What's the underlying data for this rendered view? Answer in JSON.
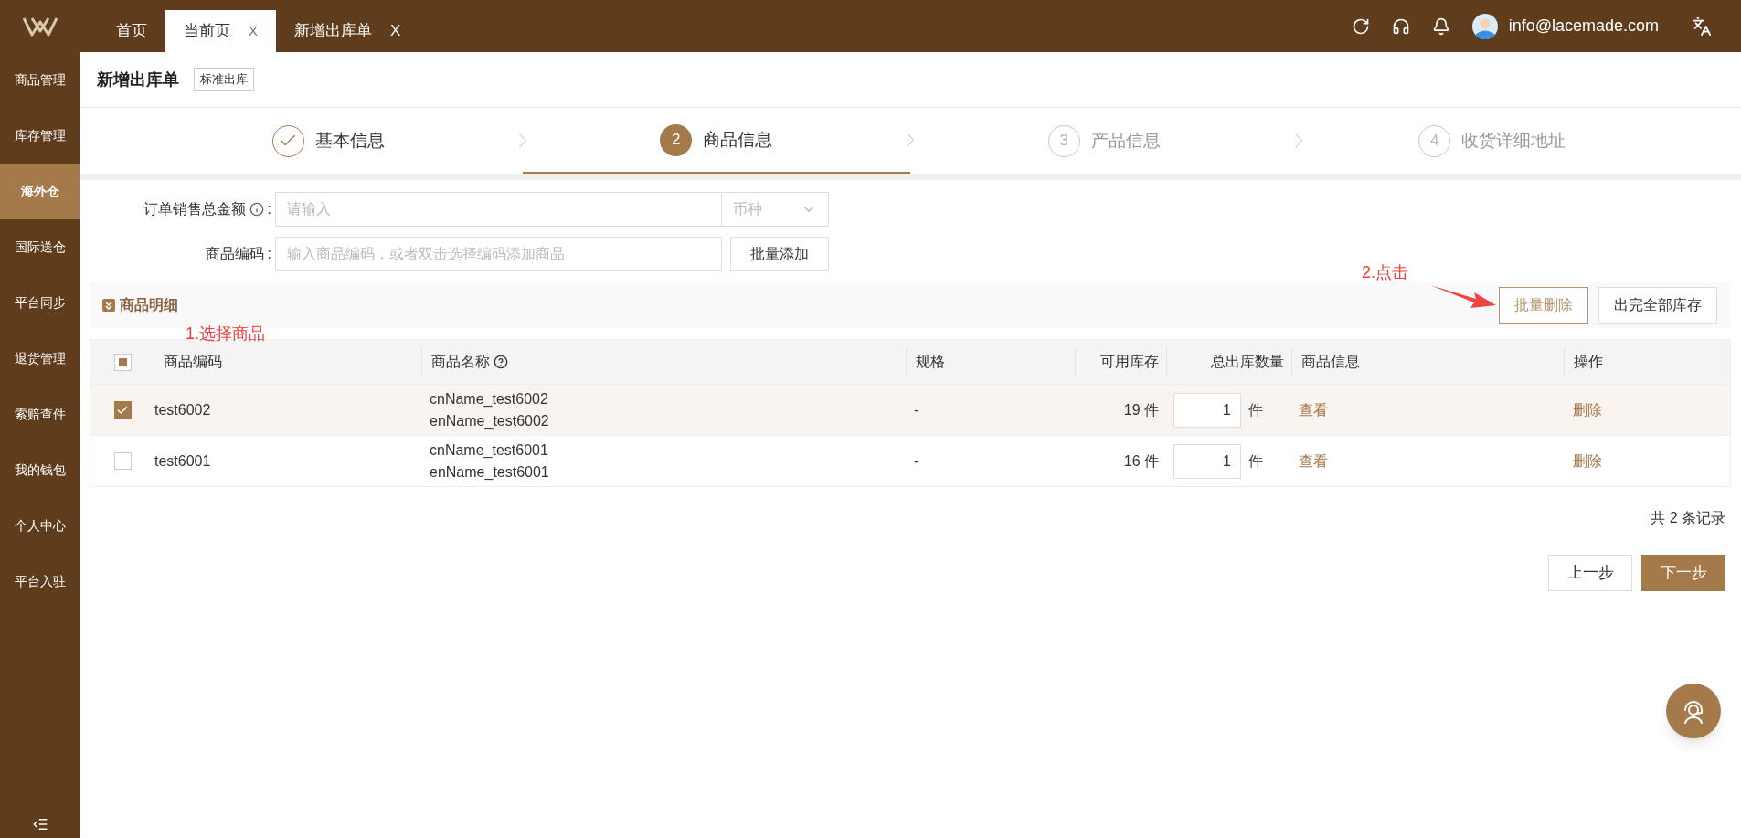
{
  "topbar": {
    "tabs": [
      {
        "label": "首页",
        "selected": false
      },
      {
        "label": "当前页",
        "selected": true,
        "close": "X"
      },
      {
        "label": "新增出库单",
        "selected": false,
        "close": "X"
      }
    ],
    "user": "info@lacemade.com"
  },
  "sidebar": {
    "items": [
      {
        "label": "商品管理",
        "selected": false
      },
      {
        "label": "库存管理",
        "selected": false
      },
      {
        "label": "海外仓",
        "selected": true
      },
      {
        "label": "国际送仓",
        "selected": false
      },
      {
        "label": "平台同步",
        "selected": false
      },
      {
        "label": "退货管理",
        "selected": false
      },
      {
        "label": "索赔查件",
        "selected": false
      },
      {
        "label": "我的钱包",
        "selected": false
      },
      {
        "label": "个人中心",
        "selected": false
      },
      {
        "label": "平台入驻",
        "selected": false
      }
    ]
  },
  "page": {
    "title": "新增出库单",
    "tag": "标准出库"
  },
  "steps": [
    {
      "label": "基本信息",
      "kind": "done"
    },
    {
      "number": "2",
      "label": "商品信息",
      "kind": "active"
    },
    {
      "number": "3",
      "label": "产品信息",
      "kind": "pending"
    },
    {
      "number": "4",
      "label": "收货详细地址",
      "kind": "pending"
    }
  ],
  "form": {
    "amount": {
      "label": "订单销售总金额",
      "colon": ":",
      "placeholder": "请输入",
      "currency_placeholder": "币种"
    },
    "code": {
      "label": "商品编码",
      "colon": ":",
      "placeholder": "输入商品编码，或者双击选择编码添加商品",
      "button": "批量添加"
    }
  },
  "section": {
    "title": "商品明细",
    "buttons": [
      {
        "label": "批量删除",
        "kind": "outline"
      },
      {
        "label": "出完全部库存",
        "kind": "plain"
      }
    ]
  },
  "annotations": [
    {
      "text": "1.选择商品"
    },
    {
      "text": "2.点击"
    }
  ],
  "table": {
    "select_all": {
      "indeterminate": true
    },
    "columns": [
      "商品编码",
      "商品名称",
      "规格",
      "可用库存",
      "总出库数量",
      "商品信息",
      "操作"
    ],
    "rows": [
      {
        "checked": true,
        "code": "test6002",
        "cn_name": "cnName_test6002",
        "en_name": "enName_test6002",
        "spec": "-",
        "stock": "19 件",
        "qty": "1",
        "unit": "件",
        "view": "查看",
        "action": "删除"
      },
      {
        "checked": false,
        "code": "test6001",
        "cn_name": "cnName_test6001",
        "en_name": "enName_test6001",
        "spec": "-",
        "stock": "16 件",
        "qty": "1",
        "unit": "件",
        "view": "查看",
        "action": "删除"
      }
    ]
  },
  "total": "共 2 条记录",
  "footer_buttons": [
    {
      "label": "上一步",
      "kind": "plain"
    },
    {
      "label": "下一步",
      "kind": "primary"
    }
  ]
}
